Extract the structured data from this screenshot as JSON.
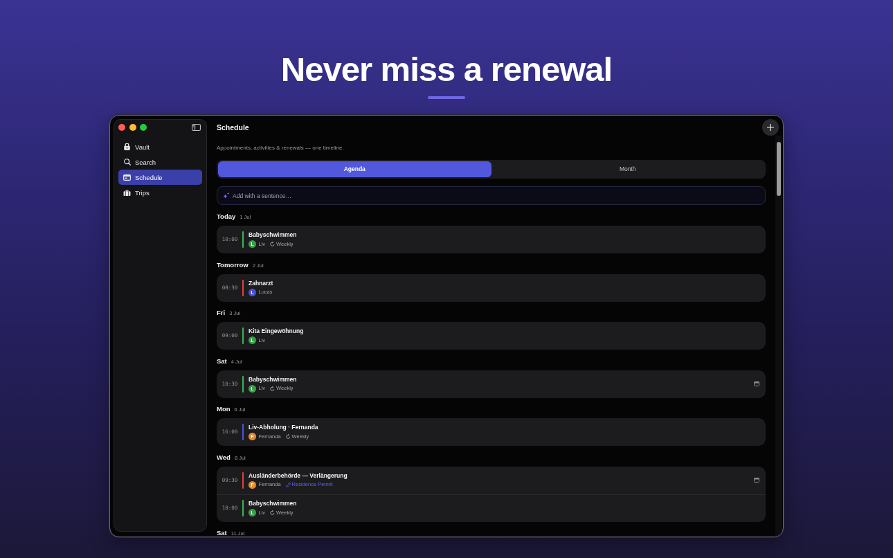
{
  "headline": "Never miss a renewal",
  "window": {
    "sidebar": {
      "items": [
        {
          "label": "Vault",
          "selected": false
        },
        {
          "label": "Search",
          "selected": false
        },
        {
          "label": "Schedule",
          "selected": true
        },
        {
          "label": "Trips",
          "selected": false
        }
      ]
    },
    "title": "Schedule",
    "subtitle": "Appointments, activities & renewals — one timeline.",
    "tabs": [
      {
        "label": "Agenda",
        "selected": true
      },
      {
        "label": "Month",
        "selected": false
      }
    ],
    "quick_add": {
      "placeholder": "Add with a sentence…"
    },
    "days": [
      {
        "day": "Today",
        "date": "1 Jul",
        "events": [
          {
            "time": "10:00",
            "title": "Babyschwimmen",
            "color": "#3cb554",
            "person": {
              "initial": "L",
              "name": "Liv",
              "color": "#37a046"
            },
            "recurrence": "Weekly",
            "calendar_mark": false
          }
        ]
      },
      {
        "day": "Tomorrow",
        "date": "2 Jul",
        "events": [
          {
            "time": "08:30",
            "title": "Zahnarzt",
            "color": "#d8453b",
            "person": {
              "initial": "L",
              "name": "Lucas",
              "color": "#4a4fd6"
            },
            "calendar_mark": false
          }
        ]
      },
      {
        "day": "Fri",
        "date": "3 Jul",
        "events": [
          {
            "time": "09:00",
            "title": "Kita Eingewöhnung",
            "color": "#3cb554",
            "person": {
              "initial": "L",
              "name": "Liv",
              "color": "#37a046"
            },
            "calendar_mark": false
          }
        ]
      },
      {
        "day": "Sat",
        "date": "4 Jul",
        "events": [
          {
            "time": "10:30",
            "title": "Babyschwimmen",
            "color": "#3cb554",
            "person": {
              "initial": "L",
              "name": "Liv",
              "color": "#37a046"
            },
            "recurrence": "Weekly",
            "calendar_mark": true
          }
        ]
      },
      {
        "day": "Mon",
        "date": "6 Jul",
        "events": [
          {
            "time": "16:00",
            "title": "Liv-Abholung · Fernanda",
            "color": "#4f54d9",
            "person": {
              "initial": "F",
              "name": "Fernanda",
              "color": "#e38a2e"
            },
            "recurrence": "Weekly",
            "calendar_mark": false
          }
        ]
      },
      {
        "day": "Wed",
        "date": "8 Jul",
        "events": [
          {
            "time": "09:30",
            "title": "Ausländerbehörde — Verlängerung",
            "color": "#d8453b",
            "person": {
              "initial": "F",
              "name": "Fernanda",
              "color": "#e38a2e"
            },
            "link": "Residence Permit",
            "calendar_mark": true
          },
          {
            "time": "10:00",
            "title": "Babyschwimmen",
            "color": "#3cb554",
            "person": {
              "initial": "L",
              "name": "Liv",
              "color": "#37a046"
            },
            "recurrence": "Weekly",
            "calendar_mark": false
          }
        ]
      },
      {
        "day": "Sat",
        "date": "11 Jul"
      }
    ]
  }
}
